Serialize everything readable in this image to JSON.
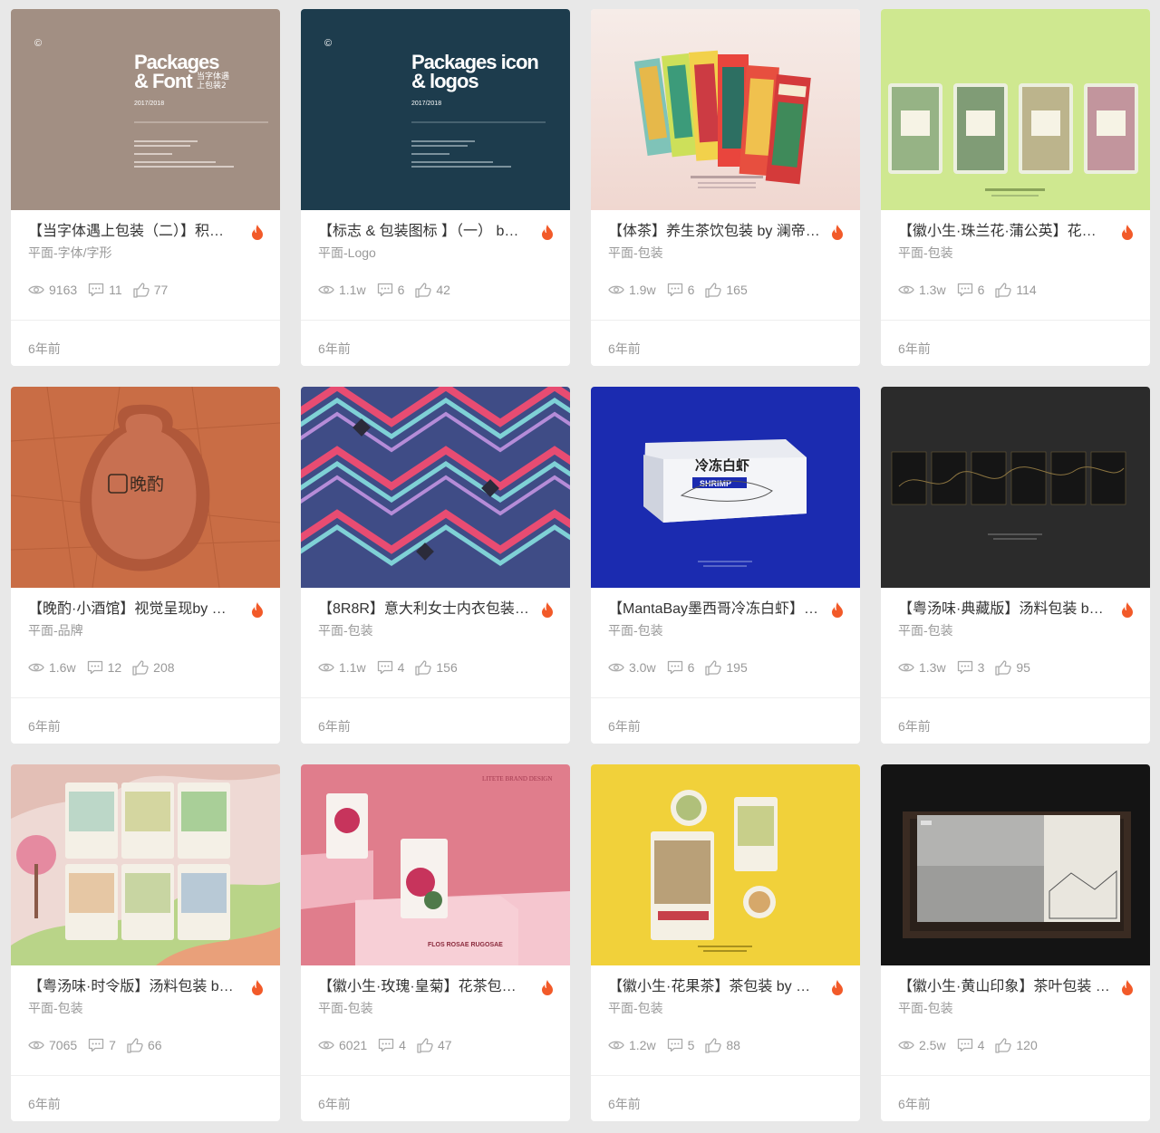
{
  "cards": [
    {
      "title": "【当字体遇上包装（二）】积…",
      "category": "平面-字体/字形",
      "views": "9163",
      "comments": "11",
      "likes": "77",
      "time": "6年前",
      "cover": {
        "text1": "Packages",
        "text2": "& Font",
        "text3": "当字体遇",
        "text4": "上包装2",
        "year": "2017/2018",
        "copyright": "©"
      }
    },
    {
      "title": "【标志 & 包装图标 】（一） b…",
      "category": "平面-Logo",
      "views": "1.1w",
      "comments": "6",
      "likes": "42",
      "time": "6年前",
      "cover": {
        "text1": "Packages icon",
        "text2": "& logos",
        "year": "2017/2018",
        "copyright": "©"
      }
    },
    {
      "title": "【体茶】养生茶饮包装 by 澜帝…",
      "category": "平面-包装",
      "views": "1.9w",
      "comments": "6",
      "likes": "165",
      "time": "6年前"
    },
    {
      "title": "【徽小生·珠兰花·蒲公英】花…",
      "category": "平面-包装",
      "views": "1.3w",
      "comments": "6",
      "likes": "114",
      "time": "6年前"
    },
    {
      "title": "【晚酌·小酒馆】视觉呈现by …",
      "category": "平面-品牌",
      "views": "1.6w",
      "comments": "12",
      "likes": "208",
      "time": "6年前",
      "cover": {
        "logo": "晚酌"
      }
    },
    {
      "title": "【8R8R】意大利女士内衣包装…",
      "category": "平面-包装",
      "views": "1.1w",
      "comments": "4",
      "likes": "156",
      "time": "6年前"
    },
    {
      "title": "【MantaBay墨西哥冷冻白虾】…",
      "category": "平面-包装",
      "views": "3.0w",
      "comments": "6",
      "likes": "195",
      "time": "6年前",
      "cover": {
        "box_text": "冷冻白虾",
        "box_sub": "SHRIMP"
      }
    },
    {
      "title": "【粤汤味·典藏版】汤料包装 b…",
      "category": "平面-包装",
      "views": "1.3w",
      "comments": "3",
      "likes": "95",
      "time": "6年前"
    },
    {
      "title": "【粤汤味·时令版】汤料包装 b…",
      "category": "平面-包装",
      "views": "7065",
      "comments": "7",
      "likes": "66",
      "time": "6年前"
    },
    {
      "title": "【徽小生·玫瑰·皇菊】花茶包…",
      "category": "平面-包装",
      "views": "6021",
      "comments": "4",
      "likes": "47",
      "time": "6年前",
      "cover": {
        "brand": "LITETE BRAND DESIGN",
        "caption": "FLOS ROSAE RUGOSAE"
      }
    },
    {
      "title": "【徽小生·花果茶】茶包装 by …",
      "category": "平面-包装",
      "views": "1.2w",
      "comments": "5",
      "likes": "88",
      "time": "6年前"
    },
    {
      "title": "【徽小生·黄山印象】茶叶包装 …",
      "category": "平面-包装",
      "views": "2.5w",
      "comments": "4",
      "likes": "120",
      "time": "6年前"
    }
  ],
  "colors": {
    "fire": "#f25a29",
    "meta": "#999999",
    "title": "#333333",
    "background": "#e8e8e8"
  }
}
